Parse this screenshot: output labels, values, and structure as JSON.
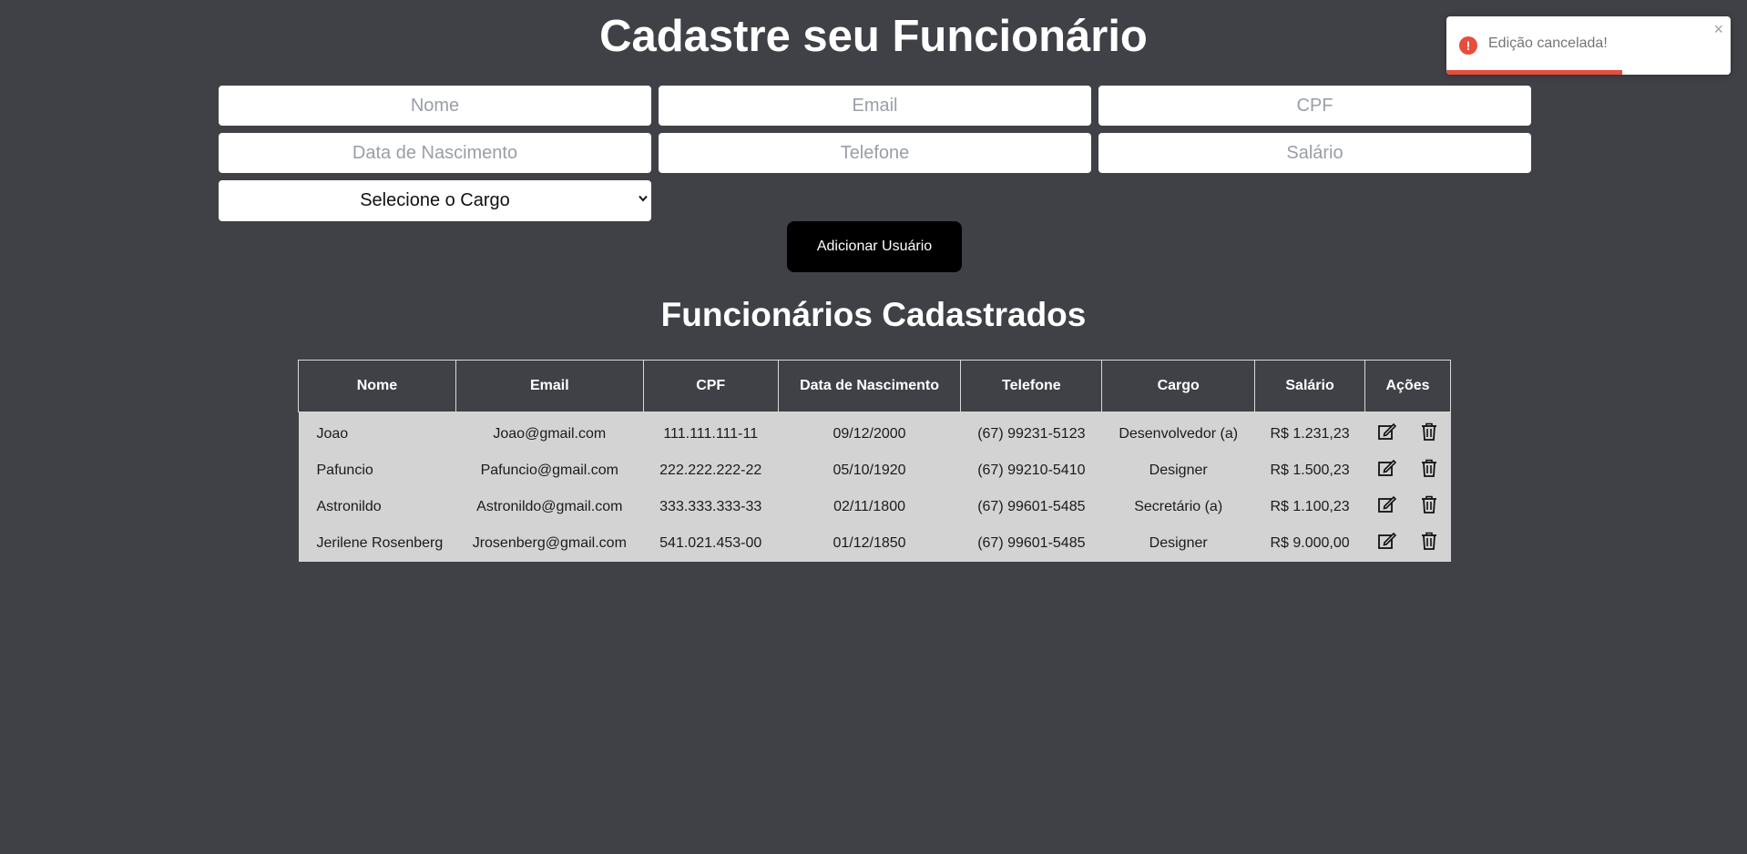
{
  "header": {
    "title": "Cadastre seu Funcionário"
  },
  "form": {
    "placeholders": {
      "nome": "Nome",
      "email": "Email",
      "cpf": "CPF",
      "nascimento": "Data de Nascimento",
      "telefone": "Telefone",
      "salario": "Salário"
    },
    "cargo_select": "Selecione o Cargo",
    "submit_label": "Adicionar Usuário"
  },
  "list": {
    "title": "Funcionários Cadastrados",
    "columns": [
      "Nome",
      "Email",
      "CPF",
      "Data de Nascimento",
      "Telefone",
      "Cargo",
      "Salário",
      "Ações"
    ],
    "rows": [
      {
        "nome": "Joao",
        "email": "Joao@gmail.com",
        "cpf": "111.111.111-11",
        "nascimento": "09/12/2000",
        "telefone": "(67) 99231-5123",
        "cargo": "Desenvolvedor (a)",
        "salario": "R$ 1.231,23"
      },
      {
        "nome": "Pafuncio",
        "email": "Pafuncio@gmail.com",
        "cpf": "222.222.222-22",
        "nascimento": "05/10/1920",
        "telefone": "(67) 99210-5410",
        "cargo": "Designer",
        "salario": "R$ 1.500,23"
      },
      {
        "nome": "Astronildo",
        "email": "Astronildo@gmail.com",
        "cpf": "333.333.333-33",
        "nascimento": "02/11/1800",
        "telefone": "(67) 99601-5485",
        "cargo": "Secretário (a)",
        "salario": "R$ 1.100,23"
      },
      {
        "nome": "Jerilene Rosenberg",
        "email": "Jrosenberg@gmail.com",
        "cpf": "541.021.453-00",
        "nascimento": "01/12/1850",
        "telefone": "(67) 99601-5485",
        "cargo": "Designer",
        "salario": "R$ 9.000,00"
      }
    ],
    "row_actions": {
      "edit_icon": "edit-icon",
      "delete_icon": "trash-icon"
    }
  },
  "toast": {
    "message": "Edição cancelada!",
    "icon": "error-icon",
    "close_glyph": "×",
    "progress_fraction": 0.62,
    "accent_color": "#e74c3c"
  },
  "theme": {
    "background": "#404147",
    "button_color": "#000000",
    "table_row_background": "#d3d3d3"
  }
}
